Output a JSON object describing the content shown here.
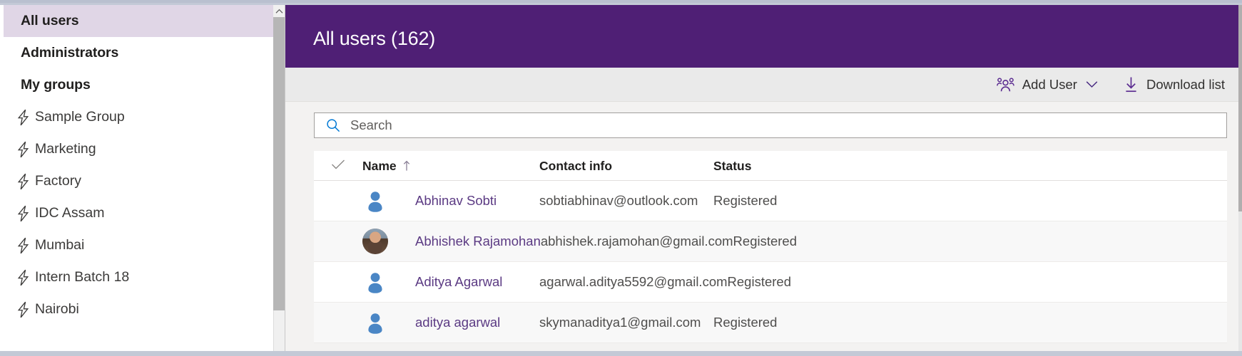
{
  "sidebar": {
    "items": [
      {
        "label": "All users",
        "type": "header",
        "selected": true,
        "icon": ""
      },
      {
        "label": "Administrators",
        "type": "header",
        "selected": false,
        "icon": ""
      },
      {
        "label": "My groups",
        "type": "header",
        "selected": false,
        "icon": ""
      },
      {
        "label": "Sample Group",
        "type": "group",
        "selected": false,
        "icon": "bolt-icon"
      },
      {
        "label": "Marketing",
        "type": "group",
        "selected": false,
        "icon": "bolt-icon"
      },
      {
        "label": "Factory",
        "type": "group",
        "selected": false,
        "icon": "bolt-icon"
      },
      {
        "label": "IDC Assam",
        "type": "group",
        "selected": false,
        "icon": "bolt-icon"
      },
      {
        "label": "Mumbai",
        "type": "group",
        "selected": false,
        "icon": "bolt-icon"
      },
      {
        "label": "Intern Batch 18",
        "type": "group",
        "selected": false,
        "icon": "bolt-icon"
      },
      {
        "label": "Nairobi",
        "type": "group",
        "selected": false,
        "icon": "bolt-icon"
      }
    ],
    "selected_background": "#e0d6e6",
    "scrollbar": {
      "up_arrow_icon": "chevron-up-icon"
    }
  },
  "header": {
    "title": "All users (162)",
    "background": "#4f1f75",
    "text_color": "#ffffff"
  },
  "toolbar": {
    "add_user_label": "Add User",
    "add_user_icon": "add-people-icon",
    "add_user_caret_icon": "chevron-down-icon",
    "download_list_label": "Download list",
    "download_list_icon": "download-icon",
    "icon_color": "#5c2d91"
  },
  "search": {
    "placeholder": "Search",
    "value": "",
    "icon": "search-icon",
    "icon_color": "#0078d4"
  },
  "table": {
    "columns": [
      {
        "key": "select",
        "label": "",
        "icon": "checkmark-icon"
      },
      {
        "key": "name",
        "label": "Name",
        "sort": "ascending",
        "sort_icon": "arrow-up-icon"
      },
      {
        "key": "contact",
        "label": "Contact info"
      },
      {
        "key": "status",
        "label": "Status"
      }
    ],
    "link_color": "#5b3a83",
    "rows": [
      {
        "name": "Abhinav Sobti",
        "contact": "sobtiabhinav@outlook.com",
        "status": "Registered",
        "avatar": "default-person-icon"
      },
      {
        "name": "Abhishek Rajamohan",
        "contact": "abhishek.rajamohan@gmail.com",
        "status": "Registered",
        "avatar": "photo-avatar"
      },
      {
        "name": "Aditya Agarwal",
        "contact": "agarwal.aditya5592@gmail.com",
        "status": "Registered",
        "avatar": "default-person-icon"
      },
      {
        "name": "aditya agarwal",
        "contact": "skymanaditya1@gmail.com",
        "status": "Registered",
        "avatar": "default-person-icon"
      }
    ]
  }
}
